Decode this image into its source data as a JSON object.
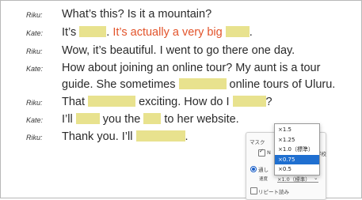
{
  "dialogue": [
    {
      "speaker": "Riku:",
      "segments": [
        {
          "t": "text",
          "v": "What’s this?  Is it a mountain?"
        }
      ]
    },
    {
      "speaker": "Kate:",
      "segments": [
        {
          "t": "text",
          "v": "It’s "
        },
        {
          "t": "blank",
          "w": 34
        },
        {
          "t": "text",
          "v": ".  "
        },
        {
          "t": "red",
          "v": "It’s actually a very big "
        },
        {
          "t": "blank",
          "w": 30
        },
        {
          "t": "text",
          "v": "."
        }
      ]
    },
    {
      "speaker": "Riku:",
      "segments": [
        {
          "t": "text",
          "v": "Wow, it’s beautiful.  I went to go there one day."
        }
      ]
    },
    {
      "speaker": "Kate:",
      "segments": [
        {
          "t": "text",
          "v": "How about joining an online tour?  My aunt is a tour"
        }
      ]
    },
    {
      "speaker": "",
      "segments": [
        {
          "t": "text",
          "v": "guide.  She sometimes "
        },
        {
          "t": "blank",
          "w": 60
        },
        {
          "t": "text",
          "v": " online tours of Uluru."
        }
      ]
    },
    {
      "speaker": "Riku:",
      "segments": [
        {
          "t": "text",
          "v": "That "
        },
        {
          "t": "blank",
          "w": 60
        },
        {
          "t": "text",
          "v": " exciting.  How do I "
        },
        {
          "t": "blank",
          "w": 42
        },
        {
          "t": "text",
          "v": "?"
        }
      ]
    },
    {
      "speaker": "Kate:",
      "segments": [
        {
          "t": "text",
          "v": "I’ll "
        },
        {
          "t": "blank",
          "w": 30
        },
        {
          "t": "text",
          "v": " you the "
        },
        {
          "t": "blank",
          "w": 22
        },
        {
          "t": "text",
          "v": " to her website."
        }
      ]
    },
    {
      "speaker": "Riku:",
      "segments": [
        {
          "t": "text",
          "v": "Thank you.  I’ll "
        },
        {
          "t": "blank",
          "w": 62
        },
        {
          "t": "text",
          "v": "."
        }
      ]
    }
  ],
  "settings_panel": {
    "mask_label": "マスク",
    "mask_check_label": "N",
    "mask_right_label": "学校",
    "radio_label": "通し",
    "speed_label": "速度",
    "speed_value": "×1.0（標準）",
    "repeat_label": "リピート読み"
  },
  "speed_dropdown": {
    "options": [
      "×1.5",
      "×1.25",
      "×1.0（標準）",
      "×0.75",
      "×0.5"
    ],
    "selected_index": 3
  },
  "colors": {
    "blank": "#e8e28e",
    "red_text": "#e2532a",
    "selection": "#1f6fd0"
  }
}
